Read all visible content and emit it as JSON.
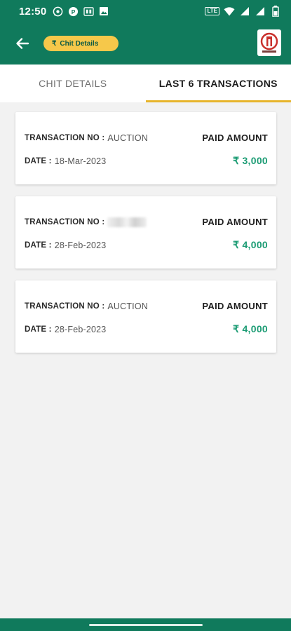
{
  "status_bar": {
    "time": "12:50",
    "network_label": "LTE",
    "icons": [
      "whatsapp-icon",
      "paytm-icon",
      "sim-card-icon",
      "image-icon",
      "volte-icon",
      "wifi-icon",
      "signal-icon",
      "battery-icon"
    ]
  },
  "app_bar": {
    "chip_label": "Chit Details",
    "colors": {
      "primary": "#107a5c",
      "chip": "#f6c84a",
      "accent_amount": "#1c9c74",
      "tab_indicator": "#e7b52c"
    }
  },
  "tabs": [
    {
      "label": "CHIT DETAILS",
      "active": false
    },
    {
      "label": "LAST 6 TRANSACTIONS",
      "active": true
    }
  ],
  "transactions": [
    {
      "txn_label": "TRANSACTION NO :",
      "txn_value": "AUCTION",
      "date_label": "DATE :",
      "date_value": "18-Mar-2023",
      "paid_label": "PAID AMOUNT",
      "amount": "₹ 3,000"
    },
    {
      "txn_label": "TRANSACTION NO :",
      "txn_value": "",
      "date_label": "DATE :",
      "date_value": "28-Feb-2023",
      "paid_label": "PAID AMOUNT",
      "amount": "₹ 4,000"
    },
    {
      "txn_label": "TRANSACTION NO :",
      "txn_value": "AUCTION",
      "date_label": "DATE :",
      "date_value": "28-Feb-2023",
      "paid_label": "PAID AMOUNT",
      "amount": "₹ 4,000"
    }
  ]
}
